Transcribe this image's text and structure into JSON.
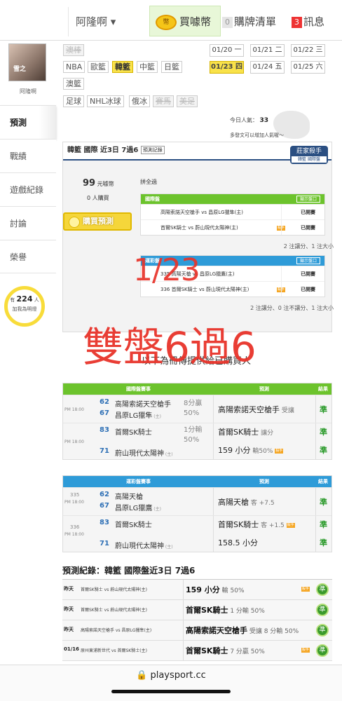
{
  "topbar": {
    "user_label": "阿隆啊 ▾",
    "buy_coin_label": "買噱幣",
    "coin_icon_text": "幣",
    "cart_count": "0",
    "cart_label": "購牌清單",
    "msg_count": "3",
    "msg_label": "訊息"
  },
  "sidebar": {
    "avatar_text": "雪之",
    "username": "阿隆啊",
    "items": [
      "預測",
      "戰績",
      "遊戲紀錄",
      "討論",
      "榮譽"
    ],
    "fans_prefix": "有",
    "fans_count": "224",
    "fans_unit": "人",
    "fans_text": "加我為明燈"
  },
  "leagues": [
    {
      "label": "澳棒",
      "state": "disabled"
    },
    {
      "label": "NBA",
      "state": "normal"
    },
    {
      "label": "歐籃",
      "state": "normal"
    },
    {
      "label": "韓籃",
      "state": "active"
    },
    {
      "label": "中籃",
      "state": "normal"
    },
    {
      "label": "日籃",
      "state": "normal"
    },
    {
      "label": "澳籃",
      "state": "normal"
    },
    {
      "label": "足球",
      "state": "normal"
    },
    {
      "label": "NHL冰球",
      "state": "normal"
    },
    {
      "label": "俄冰",
      "state": "normal"
    },
    {
      "label": "賽馬",
      "state": "disabled"
    },
    {
      "label": "美足",
      "state": "disabled"
    }
  ],
  "dates": [
    {
      "label": "01/20 一",
      "active": false
    },
    {
      "label": "01/21 二",
      "active": false
    },
    {
      "label": "01/22 三",
      "active": false
    },
    {
      "label": "01/23 四",
      "active": true
    },
    {
      "label": "01/24 五",
      "active": false
    },
    {
      "label": "01/25 六",
      "active": false
    }
  ],
  "popularity": {
    "label": "今日人氣：",
    "value": "33",
    "more": "多發文可以增加人氣喔～"
  },
  "panel": {
    "title": "韓籃 國際 近3日 7過6",
    "record_btn": "預測記錄",
    "expert_badge": "莊家殺手",
    "expert_sub": "韓籃 國際盤",
    "coins": "99",
    "coins_unit": "元噱幣",
    "buyers": "0 人購買",
    "buy_btn": "購買預測",
    "all_win": "拼全過",
    "intl_header": "國際盤",
    "show_btn": "顯示盤口",
    "intl_rows": [
      {
        "text": "高陽索諾天空槍手 vs 昌原LG獵隼(主)",
        "mark": false,
        "status": "已開賽"
      },
      {
        "text": "首爾SK騎士 vs 蔚山現代太陽神(主)",
        "mark": true,
        "status": "已開賽"
      }
    ],
    "intl_summary": "2 注讓分、1 注大小",
    "lottery_header": "運彩盤",
    "lottery_rows": [
      {
        "text": "335 高陽天槍 vs 昌原LG獵鷹(主)",
        "mark": false,
        "status": "已開賽"
      },
      {
        "text": "336 首爾SK騎士 vs 蔚山現代太陽神(主)",
        "mark": true,
        "status": "已開賽"
      }
    ],
    "lottery_summary": "2 注讓分、0 注不讓分、1 注大小"
  },
  "overlay": {
    "date": "1/23",
    "record": "雙盤6過6"
  },
  "offered_text": "以下為冊傳提供給已購買人",
  "intl_games": {
    "header": "國際盤賽事",
    "pred_header": "預測",
    "result_header": "結果",
    "games": [
      {
        "time": "PM 18:00",
        "away_no": "62",
        "away": "高陽索諾天空槍手",
        "home_no": "67",
        "home": "昌原LG獵隼",
        "home_tag": "(主)",
        "line": "8分贏",
        "pct": "50%",
        "preds": [
          {
            "team": "高陽索諾天空槍手",
            "note": "受讓",
            "mark": false,
            "result": "準"
          }
        ]
      },
      {
        "time": "PM 18:00",
        "away_no": "83",
        "away": "首爾SK騎士",
        "home_no": "71",
        "home": "蔚山現代太陽神",
        "home_tag": "(主)",
        "line": "1分輸",
        "pct": "50%",
        "preds": [
          {
            "team": "首爾SK騎士",
            "note": "讓分",
            "mark": false,
            "result": "準"
          },
          {
            "team": "159 小分",
            "note": "輸50%",
            "mark": true,
            "result": "準"
          }
        ]
      }
    ]
  },
  "lottery_games": {
    "header": "運彩盤賽事",
    "pred_header": "預測",
    "result_header": "結果",
    "games": [
      {
        "no": "335",
        "time": "PM 18:00",
        "away_no": "62",
        "away": "高陽天槍",
        "home_no": "67",
        "home": "昌原LG獵鷹",
        "home_tag": "(主)",
        "preds": [
          {
            "team": "高陽天槍",
            "note": "客 +7.5",
            "mark": false,
            "result": "準"
          }
        ]
      },
      {
        "no": "336",
        "time": "PM 18:00",
        "away_no": "83",
        "away": "首爾SK騎士",
        "home_no": "71",
        "home": "蔚山現代太陽神",
        "home_tag": "(主)",
        "preds": [
          {
            "team": "首爾SK騎士",
            "note": "客 +1.5",
            "mark": true,
            "result": "準"
          },
          {
            "team": "158.5 小分",
            "note": "",
            "mark": false,
            "result": "準"
          }
        ]
      }
    ]
  },
  "history": {
    "title": "預測紀錄：韓籃 國際盤近3日 7過6",
    "rows": [
      {
        "day": "昨天",
        "match": "首爾SK騎士 vs 蔚山現代太陽神(主)",
        "pick": "159 小分",
        "note": "輸 50%",
        "mark": true,
        "result": "準"
      },
      {
        "day": "昨天",
        "match": "首爾SK騎士 vs 蔚山現代太陽神(主)",
        "pick": "首爾SK騎士",
        "note": "1 分輸 50%",
        "mark": false,
        "result": "準"
      },
      {
        "day": "昨天",
        "match": "高陽索諾天空槍手 vs 昌原LG獵隼(主)",
        "pick": "高陽索諾天空槍手",
        "note": "受讓 8 分輸 50%",
        "mark": false,
        "result": "準"
      },
      {
        "day": "01/16",
        "match": "原州東浦新世代 vs 首爾SK騎士(主)",
        "pick": "首爾SK騎士",
        "note": "7 分贏 50%",
        "mark": true,
        "result": "準"
      }
    ]
  },
  "mark_text": "殺手",
  "vs_text": "VS",
  "browser": {
    "url": "🔒 playsport.cc"
  },
  "colors": {
    "green_header": "#6cc32c",
    "blue_header": "#2e9bd8",
    "overlay_red": "#e8332a",
    "active_yellow": "#f9e24a"
  }
}
